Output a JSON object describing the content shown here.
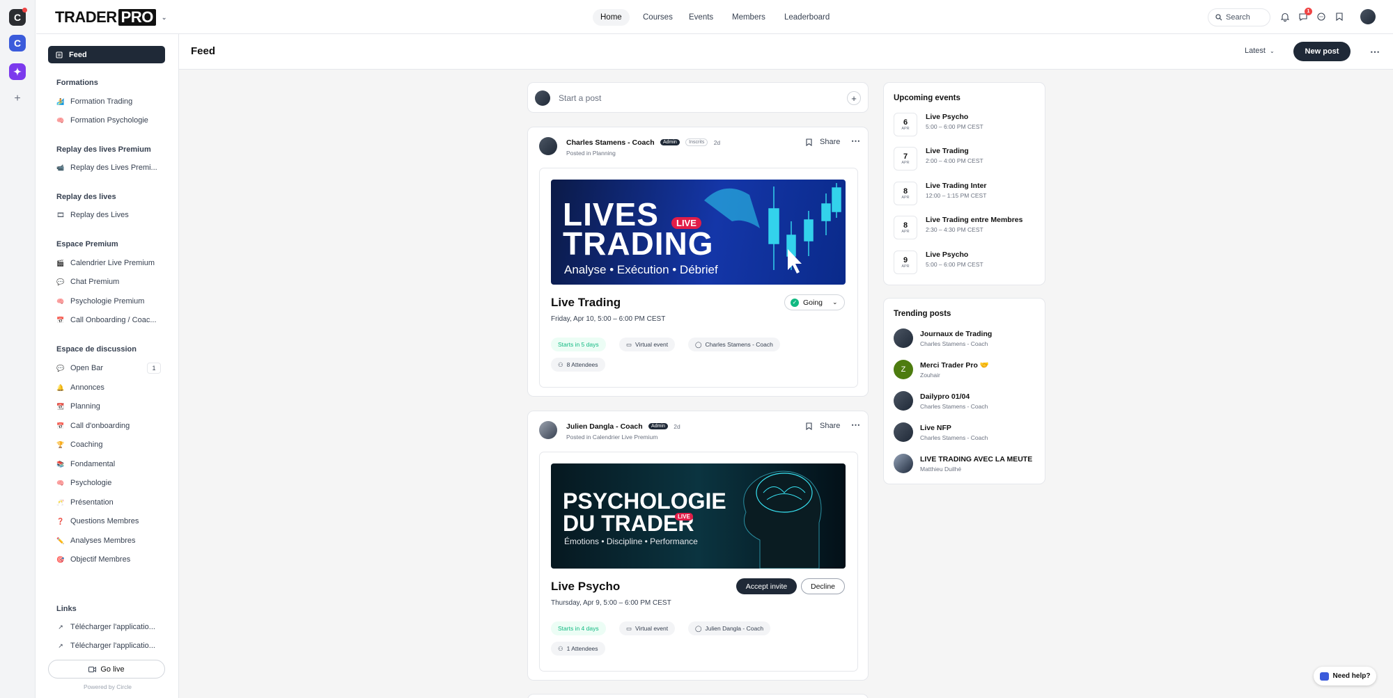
{
  "brand": {
    "logo_a": "TRADER",
    "logo_b": "PRO"
  },
  "nav": {
    "home": "Home",
    "courses": "Courses",
    "events": "Events",
    "members": "Members",
    "leaderboard": "Leaderboard"
  },
  "header": {
    "search_label": "Search",
    "chat_badge": "1"
  },
  "sidebar": {
    "feed": "Feed",
    "sections": [
      {
        "title": "Formations",
        "items": [
          {
            "emoji": "🏄",
            "label": "Formation Trading"
          },
          {
            "emoji": "🧠",
            "label": "Formation Psychologie"
          }
        ]
      },
      {
        "title": "Replay des lives Premium",
        "items": [
          {
            "emoji": "📹",
            "label": "Replay des Lives Premi..."
          }
        ]
      },
      {
        "title": "Replay des lives",
        "items": [
          {
            "emoji": "🎞",
            "label": "Replay des Lives"
          }
        ]
      },
      {
        "title": "Espace Premium",
        "items": [
          {
            "emoji": "🎬",
            "label": "Calendrier Live Premium"
          },
          {
            "emoji": "💬",
            "label": "Chat Premium"
          },
          {
            "emoji": "🧠",
            "label": "Psychologie Premium"
          },
          {
            "emoji": "📅",
            "label": "Call Onboarding / Coac..."
          }
        ]
      },
      {
        "title": "Espace de discussion",
        "items": [
          {
            "emoji": "💬",
            "label": "Open Bar",
            "count": "1"
          },
          {
            "emoji": "🔔",
            "label": "Annonces"
          },
          {
            "emoji": "📆",
            "label": "Planning"
          },
          {
            "emoji": "📅",
            "label": "Call d'onboarding"
          },
          {
            "emoji": "🏆",
            "label": "Coaching"
          },
          {
            "emoji": "📚",
            "label": "Fondamental"
          },
          {
            "emoji": "🧠",
            "label": "Psychologie"
          },
          {
            "emoji": "🥂",
            "label": "Présentation"
          },
          {
            "emoji": "❓",
            "label": "Questions Membres"
          },
          {
            "emoji": "✏️",
            "label": "Analyses Membres"
          },
          {
            "emoji": "🎯",
            "label": "Objectif Membres"
          }
        ]
      }
    ],
    "links_title": "Links",
    "links": [
      "Télécharger l'applicatio...",
      "Télécharger l'applicatio..."
    ],
    "go_live": "Go live",
    "powered": "Powered by Circle"
  },
  "page": {
    "title": "Feed",
    "sort": "Latest",
    "new_post": "New post",
    "start_post": "Start a post"
  },
  "posts": [
    {
      "author": "Charles Stamens - Coach",
      "tags": [
        "Admin",
        "Inscrits"
      ],
      "time": "2d",
      "posted_in": "Posted in Planning",
      "share": "Share",
      "banner_line1": "LIVES",
      "banner_line2": "TRADING",
      "banner_live": "LIVE",
      "banner_sub": "Analyse • Exécution • Débrief",
      "event_title": "Live Trading",
      "event_date": "Friday, Apr 10, 5:00 – 6:00 PM CEST",
      "rsvp": "Going",
      "chips": [
        "Starts in 5 days",
        "Virtual event",
        "Charles Stamens - Coach",
        "8 Attendees"
      ]
    },
    {
      "author": "Julien Dangla - Coach",
      "tags": [
        "Admin"
      ],
      "time": "2d",
      "posted_in": "Posted in Calendrier Live Premium",
      "share": "Share",
      "banner_line1": "PSYCHOLOGIE",
      "banner_line2": "DU TRADER",
      "banner_live": "LIVE",
      "banner_sub": "Émotions • Discipline • Performance",
      "event_title": "Live Psycho",
      "event_date": "Thursday, Apr 9, 5:00 – 6:00 PM CEST",
      "accept": "Accept invite",
      "decline": "Decline",
      "chips": [
        "Starts in 4 days",
        "Virtual event",
        "Julien Dangla - Coach",
        "1 Attendees"
      ]
    }
  ],
  "upcoming": {
    "title": "Upcoming events",
    "items": [
      {
        "day": "6",
        "month": "APR",
        "name": "Live Psycho",
        "time": "5:00 – 6:00 PM CEST"
      },
      {
        "day": "7",
        "month": "APR",
        "name": "Live Trading",
        "time": "2:00 – 4:00 PM CEST"
      },
      {
        "day": "8",
        "month": "APR",
        "name": "Live Trading Inter",
        "time": "12:00 – 1:15 PM CEST"
      },
      {
        "day": "8",
        "month": "APR",
        "name": "Live Trading entre Membres",
        "time": "2:30 – 4:30 PM CEST"
      },
      {
        "day": "9",
        "month": "APR",
        "name": "Live Psycho",
        "time": "5:00 – 6:00 PM CEST"
      }
    ]
  },
  "trending": {
    "title": "Trending posts",
    "items": [
      {
        "title": "Journaux de Trading",
        "author": "Charles Stamens - Coach"
      },
      {
        "title": "Merci Trader Pro 🤝",
        "author": "Zouhair",
        "initial": "Z"
      },
      {
        "title": "Dailypro 01/04",
        "author": "Charles Stamens - Coach"
      },
      {
        "title": "Live NFP",
        "author": "Charles Stamens - Coach"
      },
      {
        "title": "LIVE TRADING AVEC LA MEUTE",
        "author": "Matthieu Duilhé"
      }
    ]
  },
  "help": "Need help?"
}
